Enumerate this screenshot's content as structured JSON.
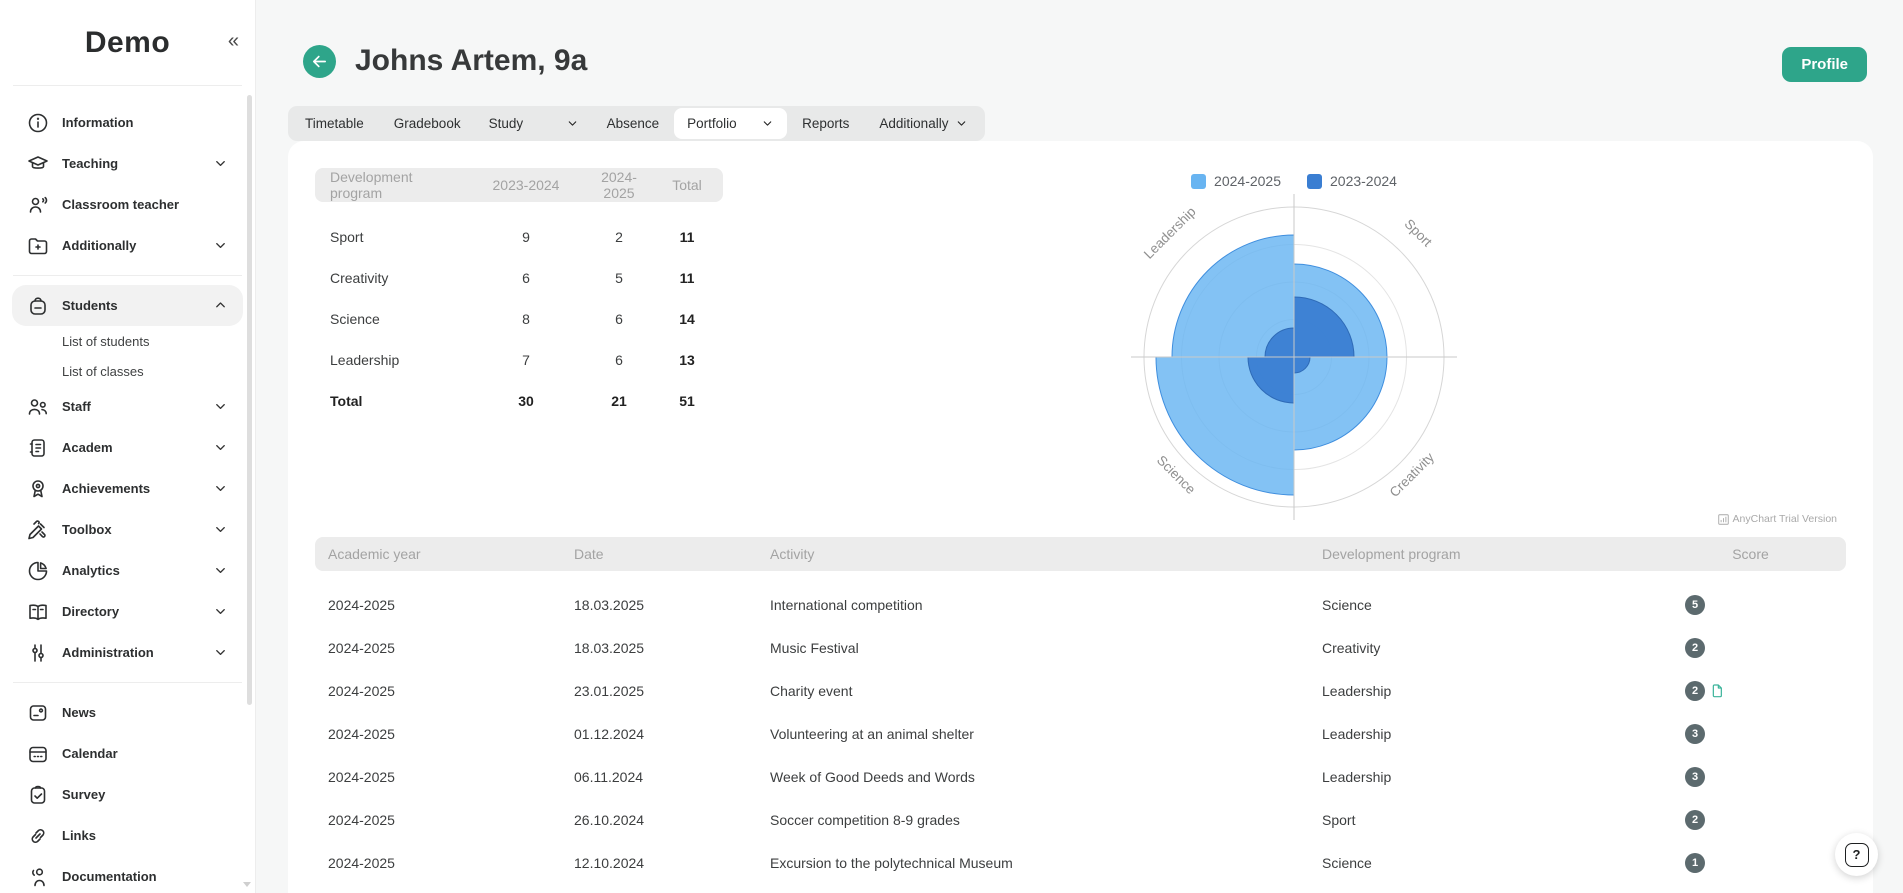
{
  "app": {
    "logo": "Demo",
    "collapse_icon": "«"
  },
  "sidebar": {
    "items": [
      {
        "label": "Information",
        "icon": "info-icon"
      },
      {
        "label": "Teaching",
        "icon": "teaching-icon",
        "chevron": "down"
      },
      {
        "label": "Classroom teacher",
        "icon": "classroom-teacher-icon"
      },
      {
        "label": "Additionally",
        "icon": "additionally-icon",
        "chevron": "down",
        "divider_after": true
      },
      {
        "label": "Students",
        "icon": "students-icon",
        "chevron": "up",
        "active": true,
        "children": [
          "List of students",
          "List of classes"
        ]
      },
      {
        "label": "Staff",
        "icon": "staff-icon",
        "chevron": "down"
      },
      {
        "label": "Academ",
        "icon": "academ-icon",
        "chevron": "down"
      },
      {
        "label": "Achievements",
        "icon": "achievements-icon",
        "chevron": "down"
      },
      {
        "label": "Toolbox",
        "icon": "toolbox-icon",
        "chevron": "down"
      },
      {
        "label": "Analytics",
        "icon": "analytics-icon",
        "chevron": "down"
      },
      {
        "label": "Directory",
        "icon": "directory-icon",
        "chevron": "down"
      },
      {
        "label": "Administration",
        "icon": "administration-icon",
        "chevron": "down",
        "divider_after": true
      },
      {
        "label": "News",
        "icon": "news-icon"
      },
      {
        "label": "Calendar",
        "icon": "calendar-icon"
      },
      {
        "label": "Survey",
        "icon": "survey-icon"
      },
      {
        "label": "Links",
        "icon": "links-icon"
      },
      {
        "label": "Documentation",
        "icon": "documentation-icon"
      }
    ]
  },
  "header": {
    "title": "Johns Artem, 9a",
    "profile_button": "Profile"
  },
  "tabs": [
    {
      "label": "Timetable"
    },
    {
      "label": "Gradebook"
    },
    {
      "label": "Study",
      "chevron": true,
      "wide": true
    },
    {
      "label": "Absence"
    },
    {
      "label": "Portfolio",
      "chevron": true,
      "active": true
    },
    {
      "label": "Reports"
    },
    {
      "label": "Additionally",
      "chevron": true
    }
  ],
  "summary_table": {
    "headers": [
      "Development program",
      "2023-2024",
      "2024-2025",
      "Total"
    ],
    "rows": [
      [
        "Sport",
        "9",
        "2",
        "11"
      ],
      [
        "Creativity",
        "6",
        "5",
        "11"
      ],
      [
        "Science",
        "8",
        "6",
        "14"
      ],
      [
        "Leadership",
        "7",
        "6",
        "13"
      ]
    ],
    "total_row": [
      "Total",
      "30",
      "21",
      "51"
    ]
  },
  "chart_data": {
    "type": "polar-bar",
    "categories": [
      "Sport",
      "Creativity",
      "Science",
      "Leadership"
    ],
    "series": [
      {
        "name": "2024-2025",
        "color": "#68b4f1",
        "stroke": "#3f8ede",
        "values": [
          2,
          5,
          6,
          6
        ]
      },
      {
        "name": "2023-2024",
        "color": "#3a7ed2",
        "stroke": "#2e6ab6",
        "values": [
          9,
          6,
          8,
          7
        ]
      }
    ],
    "legend_position": "top",
    "axis_labels": {
      "leadership": "Leadership",
      "sport": "Sport",
      "science": "Science",
      "creativity": "Creativity"
    },
    "grid_rings": [
      37.5,
      75,
      112.5,
      150
    ],
    "sector_radii": {
      "light": {
        "sport": 93,
        "creativity": 93,
        "science": 138,
        "leadership": 122
      },
      "dark": {
        "sport": 60,
        "creativity": 16,
        "science": 46,
        "leadership": 29
      }
    },
    "watermark": "AnyChart Trial Version"
  },
  "activities_table": {
    "headers": [
      "Academic year",
      "Date",
      "Activity",
      "Development program",
      "Score"
    ],
    "rows": [
      {
        "year": "2024-2025",
        "date": "18.03.2025",
        "activity": "International competition",
        "program": "Science",
        "score": "5",
        "attachment": false
      },
      {
        "year": "2024-2025",
        "date": "18.03.2025",
        "activity": "Music Festival",
        "program": "Creativity",
        "score": "2",
        "attachment": false
      },
      {
        "year": "2024-2025",
        "date": "23.01.2025",
        "activity": "Charity event",
        "program": "Leadership",
        "score": "2",
        "attachment": true
      },
      {
        "year": "2024-2025",
        "date": "01.12.2024",
        "activity": "Volunteering at an animal shelter",
        "program": "Leadership",
        "score": "3",
        "attachment": false
      },
      {
        "year": "2024-2025",
        "date": "06.11.2024",
        "activity": "Week of Good Deeds and Words",
        "program": "Leadership",
        "score": "3",
        "attachment": false
      },
      {
        "year": "2024-2025",
        "date": "26.10.2024",
        "activity": "Soccer competition 8-9 grades",
        "program": "Sport",
        "score": "2",
        "attachment": false
      },
      {
        "year": "2024-2025",
        "date": "12.10.2024",
        "activity": "Excursion to the polytechnical Museum",
        "program": "Science",
        "score": "1",
        "attachment": false
      }
    ]
  },
  "help_button": {
    "label": "?"
  },
  "colors": {
    "accent_teal": "#2ea58a",
    "light_blue": "#68b4f1",
    "dark_blue": "#3a7ed2",
    "score_badge": "#5c6a6e",
    "attachment_icon": "#3ab39a"
  }
}
